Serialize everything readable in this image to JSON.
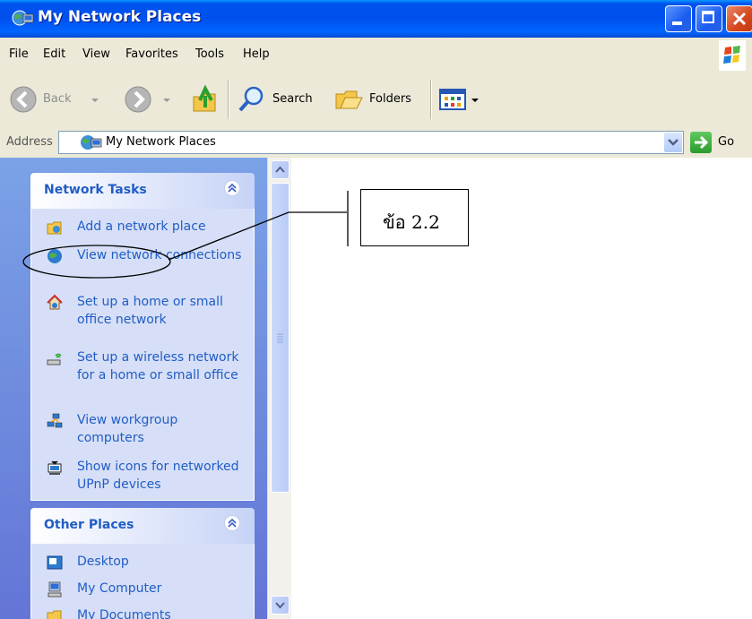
{
  "window": {
    "title": "My Network Places",
    "controls": [
      "minimize",
      "maximize",
      "close"
    ]
  },
  "menu": [
    "File",
    "Edit",
    "View",
    "Favorites",
    "Tools",
    "Help"
  ],
  "toolbar": {
    "back_label": "Back",
    "search_label": "Search",
    "folders_label": "Folders"
  },
  "address": {
    "label": "Address",
    "value": "My Network Places",
    "go_label": "Go"
  },
  "network_tasks": {
    "title": "Network Tasks",
    "items": [
      {
        "label": "Add a network place",
        "icon": "network-place-icon"
      },
      {
        "label": "View network connections",
        "icon": "network-connections-icon"
      },
      {
        "label": "Set up a home or small office network",
        "icon": "home-network-icon"
      },
      {
        "label": "Set up a wireless network for a home or small office",
        "icon": "wireless-icon"
      },
      {
        "label": "View workgroup computers",
        "icon": "workgroup-icon"
      },
      {
        "label": "Show icons for networked UPnP devices",
        "icon": "upnp-icon"
      }
    ]
  },
  "other_places": {
    "title": "Other Places",
    "items": [
      {
        "label": "Desktop",
        "icon": "desktop-icon"
      },
      {
        "label": "My Computer",
        "icon": "my-computer-icon"
      },
      {
        "label": "My Documents",
        "icon": "my-documents-icon"
      }
    ]
  },
  "annotation": {
    "label": "ข้อ 2.2"
  }
}
